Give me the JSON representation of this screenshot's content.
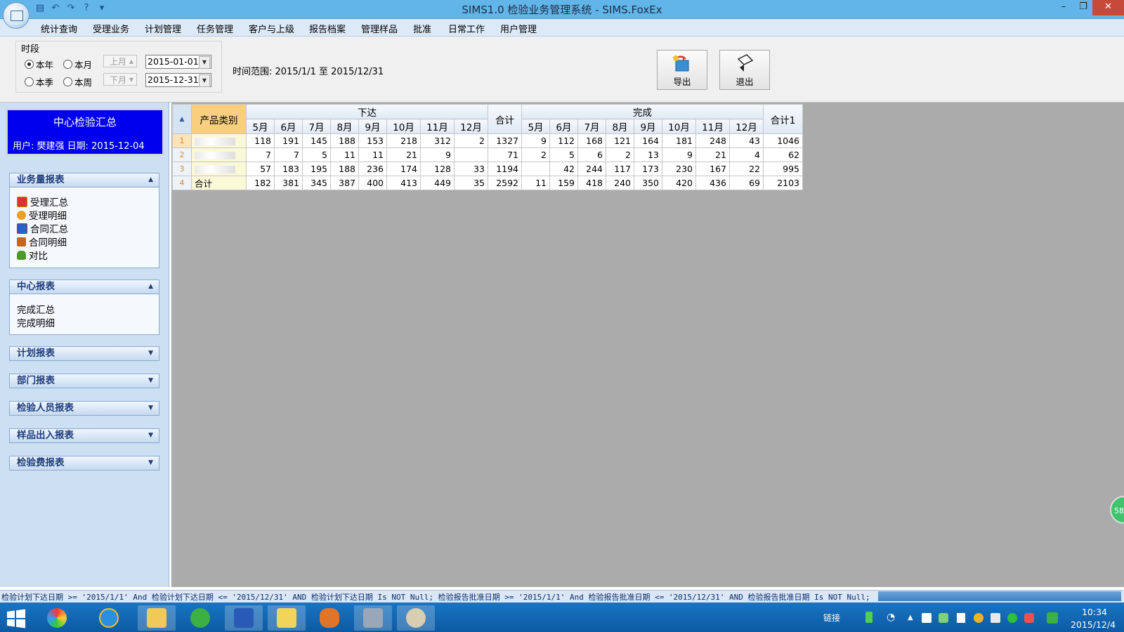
{
  "window": {
    "title": "SIMS1.0 检验业务管理系统 - SIMS.FoxEx",
    "controls": {
      "minimize": "–",
      "restore": "❐",
      "close": "✕"
    }
  },
  "quick_access": [
    "save-icon",
    "undo-icon",
    "redo-icon",
    "help-icon",
    "dropdown-icon"
  ],
  "menu": [
    "统计查询",
    "受理业务",
    "计划管理",
    "任务管理",
    "客户与上级",
    "报告档案",
    "管理样品",
    "批准",
    "日常工作",
    "用户管理"
  ],
  "filter": {
    "group_label": "时段",
    "radios": [
      {
        "label": "本年",
        "checked": true
      },
      {
        "label": "本月",
        "checked": false
      },
      {
        "label": "本季",
        "checked": false
      },
      {
        "label": "本周",
        "checked": false
      }
    ],
    "prev_month": "上月",
    "next_month": "下月",
    "start_date": "2015-01-01",
    "end_date": "2015-12-31",
    "time_range": "时间范围: 2015/1/1 至 2015/12/31",
    "export_label": "导出",
    "exit_label": "退出"
  },
  "sidebar": {
    "title": "中心检验汇总",
    "user_line": "用户: 樊建强   日期: 2015-12-04",
    "groups": [
      {
        "label": "业务量报表",
        "expanded": true,
        "items": [
          "受理汇总",
          "受理明细",
          "合同汇总",
          "合同明细",
          "对比"
        ]
      },
      {
        "label": "中心报表",
        "expanded": true,
        "items": [
          "完成汇总",
          "完成明细"
        ]
      },
      {
        "label": "计划报表",
        "expanded": false,
        "items": []
      },
      {
        "label": "部门报表",
        "expanded": false,
        "items": []
      },
      {
        "label": "检验人员报表",
        "expanded": false,
        "items": []
      },
      {
        "label": "样品出入报表",
        "expanded": false,
        "items": []
      },
      {
        "label": "检验费报表",
        "expanded": false,
        "items": []
      }
    ]
  },
  "table": {
    "corner": "▲",
    "category_header": "产品类别",
    "issued_header": "下达",
    "completed_header": "完成",
    "total_header": "合计",
    "total1_header": "合计1",
    "months": [
      "5月",
      "6月",
      "7月",
      "8月",
      "9月",
      "10月",
      "11月",
      "12月"
    ],
    "rows": [
      {
        "no": "1",
        "category": "",
        "issued": [
          "118",
          "191",
          "145",
          "188",
          "153",
          "218",
          "312",
          "2"
        ],
        "total": "1327",
        "completed": [
          "9",
          "112",
          "168",
          "121",
          "164",
          "181",
          "248",
          "43"
        ],
        "total1": "1046"
      },
      {
        "no": "2",
        "category": "",
        "issued": [
          "7",
          "7",
          "5",
          "11",
          "11",
          "21",
          "9",
          ""
        ],
        "total": "71",
        "completed": [
          "2",
          "5",
          "6",
          "2",
          "13",
          "9",
          "21",
          "4"
        ],
        "total1": "62"
      },
      {
        "no": "3",
        "category": "",
        "issued": [
          "57",
          "183",
          "195",
          "188",
          "236",
          "174",
          "128",
          "33"
        ],
        "total": "1194",
        "completed": [
          "",
          "42",
          "244",
          "117",
          "173",
          "230",
          "167",
          "22"
        ],
        "total1": "995"
      },
      {
        "no": "4",
        "category": "合计",
        "issued": [
          "182",
          "381",
          "345",
          "387",
          "400",
          "413",
          "449",
          "35"
        ],
        "total": "2592",
        "completed": [
          "11",
          "159",
          "418",
          "240",
          "350",
          "420",
          "436",
          "69"
        ],
        "total1": "2103"
      }
    ]
  },
  "status": {
    "query": "检验计划下达日期 >= '2015/1/1' And 检验计划下达日期 <= '2015/12/31' AND 检验计划下达日期 Is NOT Null; 检验报告批准日期 >= '2015/1/1' And 检验报告批准日期 <= '2015/12/31' AND 检验报告批准日期 Is NOT Null;"
  },
  "taskbar": {
    "apps": [
      "360-icon",
      "ie-icon",
      "explorer-icon",
      "360-browser-icon",
      "wps-writer-icon",
      "help-icon",
      "foxmail-icon",
      "tool-icon",
      "paint-icon"
    ],
    "tray_label": "链接",
    "time": "10:34",
    "date": "2015/12/4"
  },
  "badge": "58"
}
